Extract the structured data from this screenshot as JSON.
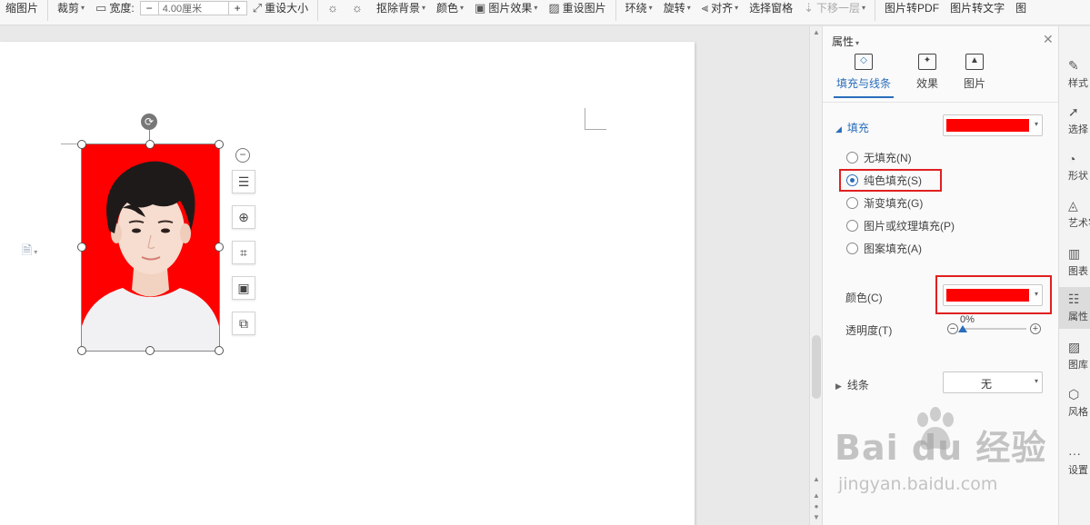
{
  "ribbon": {
    "items": [
      {
        "label": "缩图片",
        "caret": false
      },
      {
        "label": "裁剪",
        "caret": true
      },
      {
        "label": "宽度:",
        "caret": false
      },
      {
        "label": "重设大小",
        "caret": false
      },
      {
        "label": "抠除背景",
        "caret": true
      },
      {
        "label": "颜色",
        "caret": true
      },
      {
        "label": "图片效果",
        "caret": true
      },
      {
        "label": "重设图片",
        "caret": false
      },
      {
        "label": "环绕",
        "caret": true
      },
      {
        "label": "旋转",
        "caret": true
      },
      {
        "label": "对齐",
        "caret": true
      },
      {
        "label": "选择窗格",
        "caret": false
      },
      {
        "label": "下移一层",
        "caret": true
      },
      {
        "label": "图片转PDF",
        "caret": false
      },
      {
        "label": "图片转文字",
        "caret": false
      },
      {
        "label": "图",
        "caret": false
      }
    ],
    "width_value": "4.00厘米",
    "minus": "−",
    "plus": "+"
  },
  "panel": {
    "title": "属性",
    "tabs": [
      {
        "label": "填充与线条",
        "icon": "fill-bucket-icon",
        "active": true
      },
      {
        "label": "效果",
        "icon": "effect-icon",
        "active": false
      },
      {
        "label": "图片",
        "icon": "picture-icon",
        "active": false
      }
    ],
    "fill_section": {
      "label": "填充",
      "swatch_color": "#ff0000",
      "options": [
        {
          "label": "无填充(N)",
          "checked": false
        },
        {
          "label": "纯色填充(S)",
          "checked": true
        },
        {
          "label": "渐变填充(G)",
          "checked": false
        },
        {
          "label": "图片或纹理填充(P)",
          "checked": false
        },
        {
          "label": "图案填充(A)",
          "checked": false
        }
      ],
      "color_label": "颜色(C)",
      "color_value": "#ff0000",
      "transparency_label": "透明度(T)",
      "transparency_value": "0%"
    },
    "line_section": {
      "label": "线条",
      "value": "无"
    }
  },
  "sidebar": {
    "items": [
      {
        "label": "样式",
        "icon": "brush-icon"
      },
      {
        "label": "选择",
        "icon": "cursor-icon"
      },
      {
        "label": "形状",
        "icon": "shapes-icon"
      },
      {
        "label": "艺术字",
        "icon": "art-text-icon"
      },
      {
        "label": "图表",
        "icon": "chart-icon"
      },
      {
        "label": "属性",
        "icon": "properties-icon",
        "active": true
      },
      {
        "label": "图库",
        "icon": "gallery-icon"
      },
      {
        "label": "风格",
        "icon": "style-icon"
      },
      {
        "label": "设置",
        "icon": "more-icon"
      }
    ]
  },
  "watermark": {
    "main": "Bai du 经验",
    "sub": "jingyan.baidu.com"
  },
  "colors": {
    "accent": "#2a6ebb",
    "highlight": "#e02020",
    "photo_background": "#ff0000"
  }
}
